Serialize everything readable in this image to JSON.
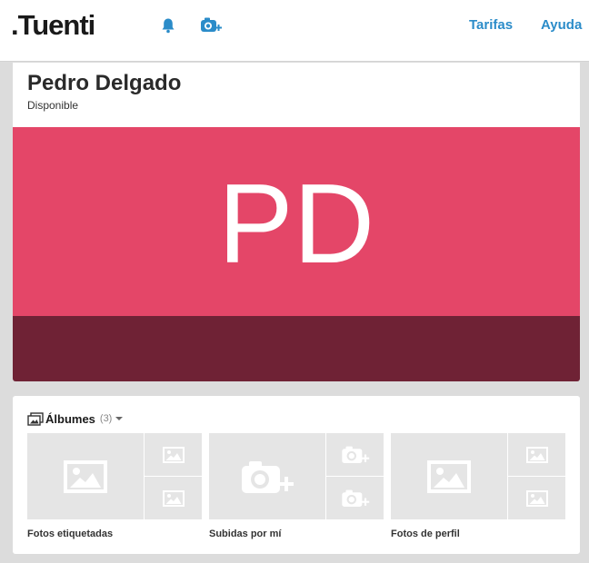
{
  "header": {
    "logo_text": ".Tuenti",
    "nav": {
      "tarifas": "Tarifas",
      "ayuda": "Ayuda"
    },
    "icons": {
      "notifications": "bell-icon",
      "upload": "camera-add-icon"
    },
    "colors": {
      "link": "#2b8cc9"
    }
  },
  "profile": {
    "name": "Pedro Delgado",
    "status": "Disponible",
    "initials": "PD",
    "colors": {
      "banner": "#e44668",
      "banner_bottom": "#6f2235"
    }
  },
  "albums": {
    "title": "Álbumes",
    "count": "(3)",
    "items": [
      {
        "label": "Fotos etiquetadas",
        "icon": "picture-icon"
      },
      {
        "label": "Subidas por mí",
        "icon": "camera-add-icon"
      },
      {
        "label": "Fotos de perfil",
        "icon": "picture-icon"
      }
    ]
  }
}
